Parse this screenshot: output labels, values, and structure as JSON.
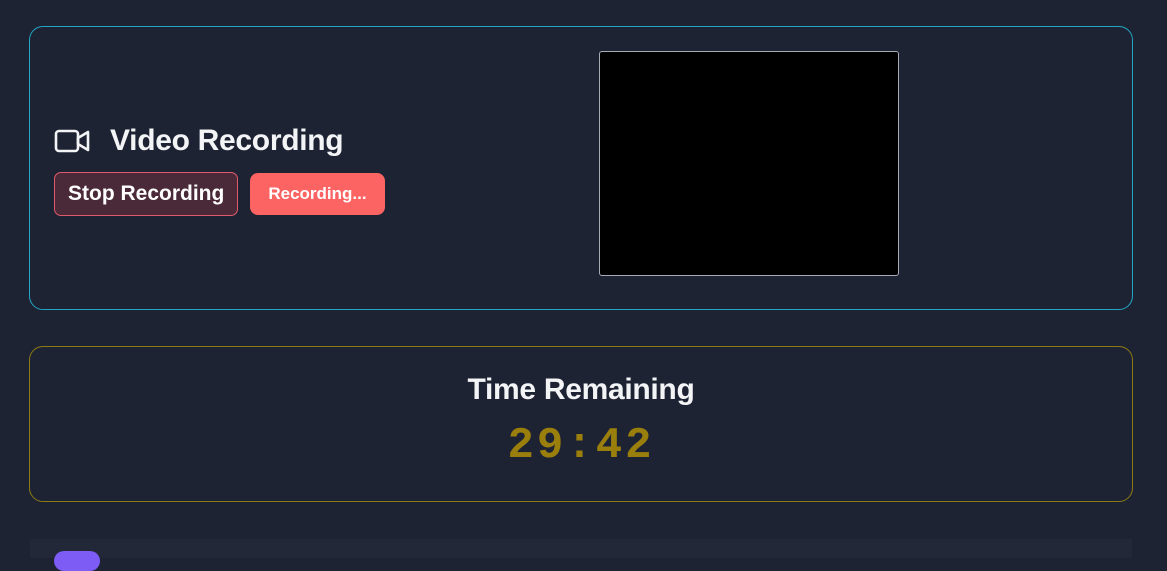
{
  "video_section": {
    "icon": "video-camera-icon",
    "title": "Video Recording",
    "stop_button_label": "Stop Recording",
    "status_button_label": "Recording..."
  },
  "timer_section": {
    "label": "Time Remaining",
    "value": "29:42"
  },
  "colors": {
    "background": "#1e2334",
    "video_card_border": "#22a6c4",
    "timer_card_border": "#8c7a14",
    "timer_value": "#9a7f0c",
    "stop_button_bg": "#4a2a38",
    "stop_button_border": "#e05a6c",
    "recording_button_bg": "#fc6363",
    "next_section_icon": "#7c5cf5"
  },
  "next_section": {
    "icon": "purple-badge-icon"
  }
}
